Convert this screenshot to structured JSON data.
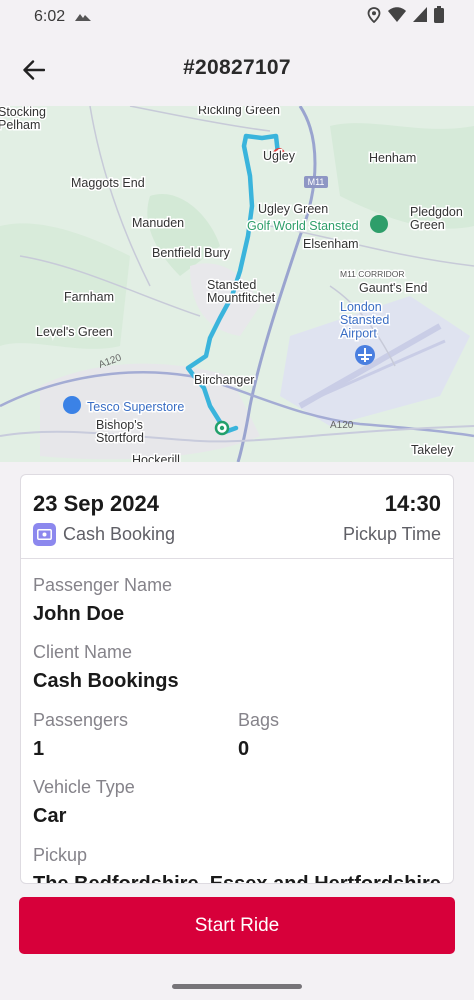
{
  "status": {
    "time": "6:02"
  },
  "header": {
    "title": "#20827107"
  },
  "map": {
    "places": {
      "stocking_pelham": "Stocking\nPelham",
      "rickling_green": "Rickling Green",
      "ugley": "Ugley",
      "henham": "Henham",
      "maggots_end": "Maggots End",
      "manuden": "Manuden",
      "ugley_green": "Ugley Green",
      "golf_world": "Golf World Stansted",
      "pledgdon_green": "Pledgdon\nGreen",
      "elsenham": "Elsenham",
      "bentfield_bury": "Bentfield Bury",
      "stansted": "Stansted\nMountfitchet",
      "m11_corridor": "M11 CORRIDOR",
      "gaunts_end": "Gaunt's End",
      "farnham": "Farnham",
      "london_stansted": "London\nStansted\nAirport",
      "levels_green": "Level's Green",
      "birchanger": "Birchanger",
      "tesco": "Tesco Superstore",
      "bishops_stortford": "Bishop's\nStortford",
      "takeley": "Takeley",
      "hockerill": "Hockerill"
    },
    "roads": {
      "m11": "M11",
      "a120_left": "A120",
      "a120_right": "A120"
    },
    "colors": {
      "route": "#3ab4dc",
      "water": "#e3eee6",
      "airport": "#dfe3f0"
    }
  },
  "booking": {
    "date": "23 Sep 2024",
    "time": "14:30",
    "type": "Cash Booking",
    "time_label": "Pickup Time",
    "passenger_name_label": "Passenger Name",
    "passenger_name": "John Doe",
    "client_name_label": "Client Name",
    "client_name": "Cash Bookings",
    "passengers_label": "Passengers",
    "passengers": "1",
    "bags_label": "Bags",
    "bags": "0",
    "vehicle_type_label": "Vehicle Type",
    "vehicle_type": "Car",
    "pickup_label": "Pickup",
    "pickup": "The Bedfordshire, Essex and Hertfordshire"
  },
  "actions": {
    "start_ride": "Start Ride"
  },
  "accent": "#d7003a"
}
